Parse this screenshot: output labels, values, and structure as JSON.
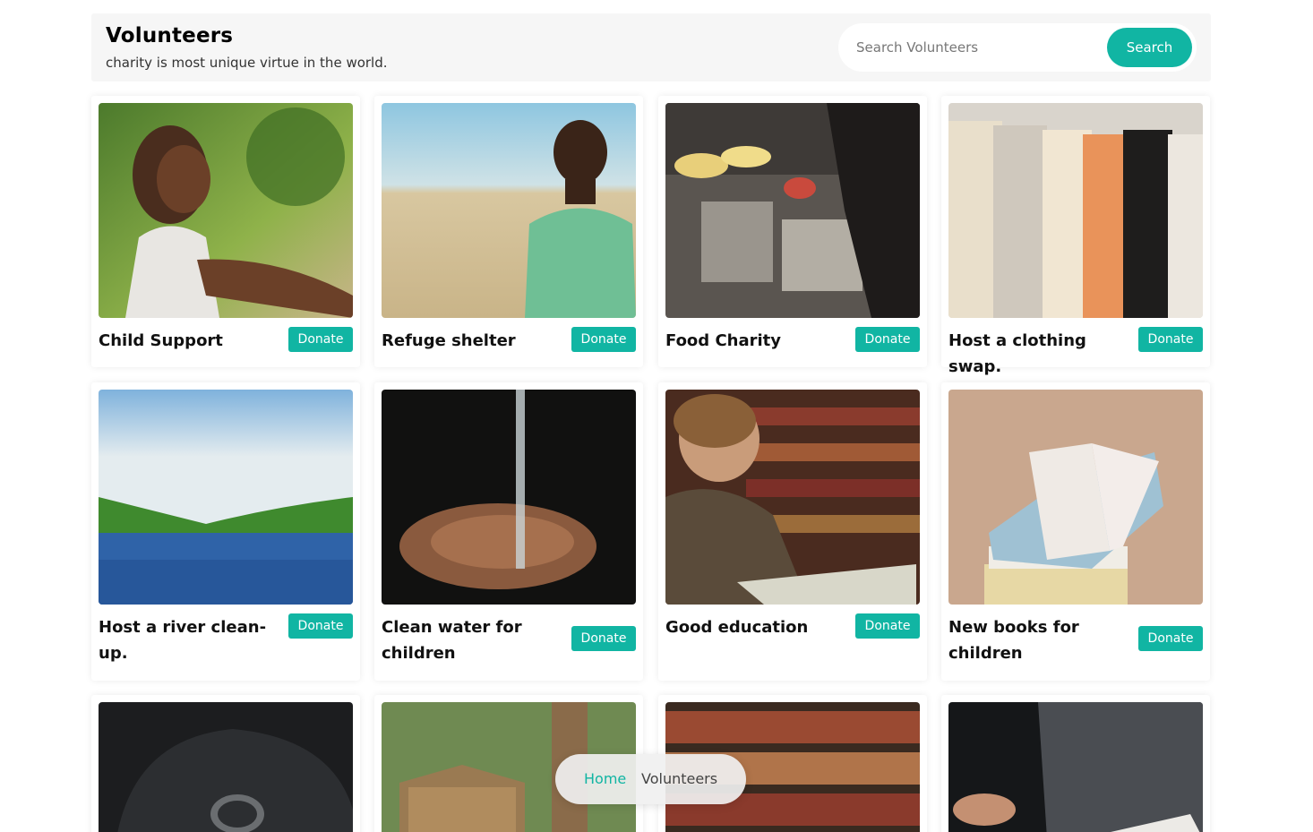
{
  "header": {
    "title": "Volunteers",
    "subtitle": "charity is most unique virtue in the world.",
    "search_placeholder": "Search Volunteers",
    "search_button": "Search"
  },
  "cards": [
    {
      "title": "Child Support",
      "button": "Donate"
    },
    {
      "title": "Refuge shelter",
      "button": "Donate"
    },
    {
      "title": "Food Charity",
      "button": "Donate"
    },
    {
      "title": "Host a clothing swap.",
      "button": "Donate"
    },
    {
      "title": "Host a river clean-up.",
      "button": "Donate"
    },
    {
      "title": "Clean water for children",
      "button": "Donate"
    },
    {
      "title": "Good education",
      "button": "Donate"
    },
    {
      "title": "New books for children",
      "button": "Donate"
    }
  ],
  "breadcrumb": {
    "home": "Home",
    "current": "Volunteers"
  },
  "colors": {
    "accent": "#11b5a3",
    "header_bg": "#f6f6f6"
  }
}
